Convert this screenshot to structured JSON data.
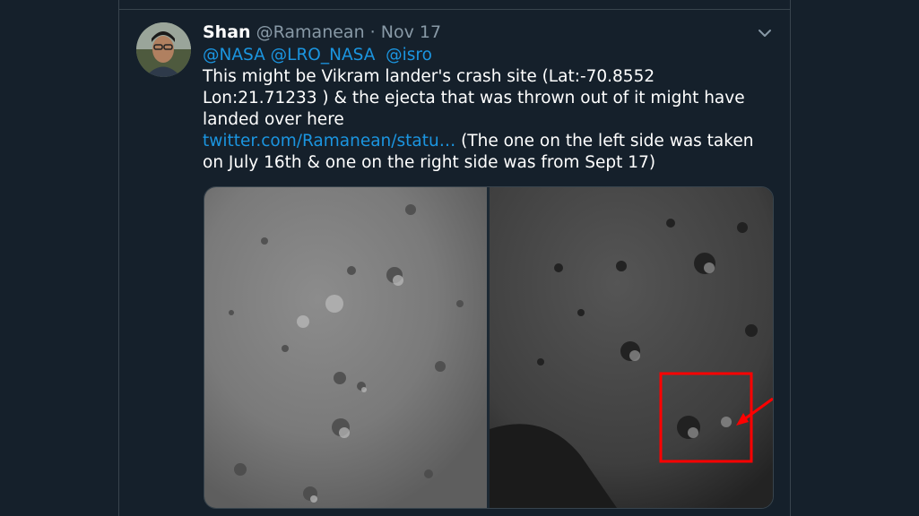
{
  "tweet": {
    "display_name": "Shan",
    "handle": "@Ramanean",
    "separator": "·",
    "date": "Nov 17",
    "mentions": [
      "@NASA",
      "@LRO_NASA",
      "@isro"
    ],
    "text_line": "This might be Vikram lander's crash site (Lat:-70.8552 Lon:21.71233 )  & the ejecta that was thrown out of it might have landed over here",
    "link": "twitter.com/Ramanean/statu…",
    "text_after_link": " (The one on the left side was taken on July 16th & one on the right side was from Sept 17)"
  },
  "icons": {
    "more": "chevron-down-icon"
  },
  "colors": {
    "background": "#15202b",
    "link": "#1b95e0",
    "annotation": "#ff0000"
  }
}
